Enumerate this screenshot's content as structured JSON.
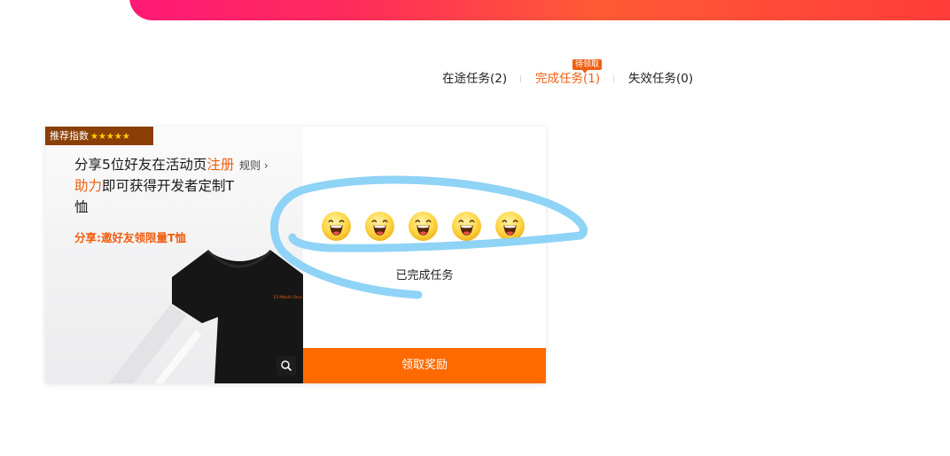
{
  "tabs": {
    "in_progress": "在途任务(2)",
    "completed": "完成任务(1)",
    "expired": "失效任务(0)",
    "completed_badge": "待领取"
  },
  "card": {
    "recommend_label": "推荐指数",
    "recommend_stars": "★★★★★",
    "recommend_rating": 5,
    "desc_part1": "分享5位好友在活动页",
    "desc_highlight": "注册助力",
    "desc_part2": "即可获得开发者定制T恤",
    "rules_label": "规则 ›",
    "share_note": "分享:邀好友领限量T恤",
    "done_label": "已完成任务",
    "claim_button": "领取奖励",
    "emoji_count": 5,
    "tshirt_logo": "E3 Miaolin Devs"
  },
  "colors": {
    "accent": "#f05e11",
    "button": "#ff6a00",
    "badge_bg": "#8b3f07",
    "scribble": "#8fd3f6"
  },
  "icons": {
    "zoom": "search-icon",
    "emoji": "grinning-face-icon"
  }
}
